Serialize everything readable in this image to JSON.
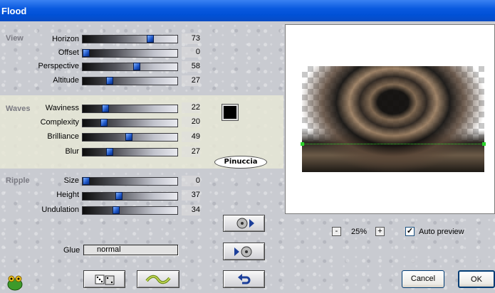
{
  "window": {
    "title": "Flood"
  },
  "sections": {
    "view": {
      "title": "View",
      "params": [
        {
          "label": "Horizon",
          "value": "73",
          "level": 73
        },
        {
          "label": "Offset",
          "value": "0",
          "level": 0
        },
        {
          "label": "Perspective",
          "value": "58",
          "level": 58
        },
        {
          "label": "Altitude",
          "value": "27",
          "level": 27
        }
      ]
    },
    "waves": {
      "title": "Waves",
      "params": [
        {
          "label": "Waviness",
          "value": "22",
          "level": 22
        },
        {
          "label": "Complexity",
          "value": "20",
          "level": 20
        },
        {
          "label": "Brilliance",
          "value": "49",
          "level": 49
        },
        {
          "label": "Blur",
          "value": "27",
          "level": 27
        }
      ],
      "color": "#000000"
    },
    "ripple": {
      "title": "Ripple",
      "params": [
        {
          "label": "Size",
          "value": "0",
          "level": 0
        },
        {
          "label": "Height",
          "value": "37",
          "level": 37
        },
        {
          "label": "Undulation",
          "value": "34",
          "level": 34
        }
      ]
    }
  },
  "watermark": "Pinuccia",
  "glue": {
    "label": "Glue",
    "value": "normal"
  },
  "preview": {
    "zoom": "25%",
    "zoom_out": "-",
    "zoom_in": "+",
    "auto_preview_label": "Auto preview",
    "auto_preview_checked": true
  },
  "buttons": {
    "cancel": "Cancel",
    "ok": "OK"
  },
  "icons": {
    "app": "frog-icon",
    "random": "dice-icon",
    "reset": "wave-icon",
    "load": "disc-load-icon",
    "save": "disc-save-icon",
    "undo": "undo-arrow-icon"
  },
  "colors": {
    "titlebar": "#0a5ae0",
    "band": "#e8e8d6",
    "slider_thumb": "#1c54c6"
  }
}
